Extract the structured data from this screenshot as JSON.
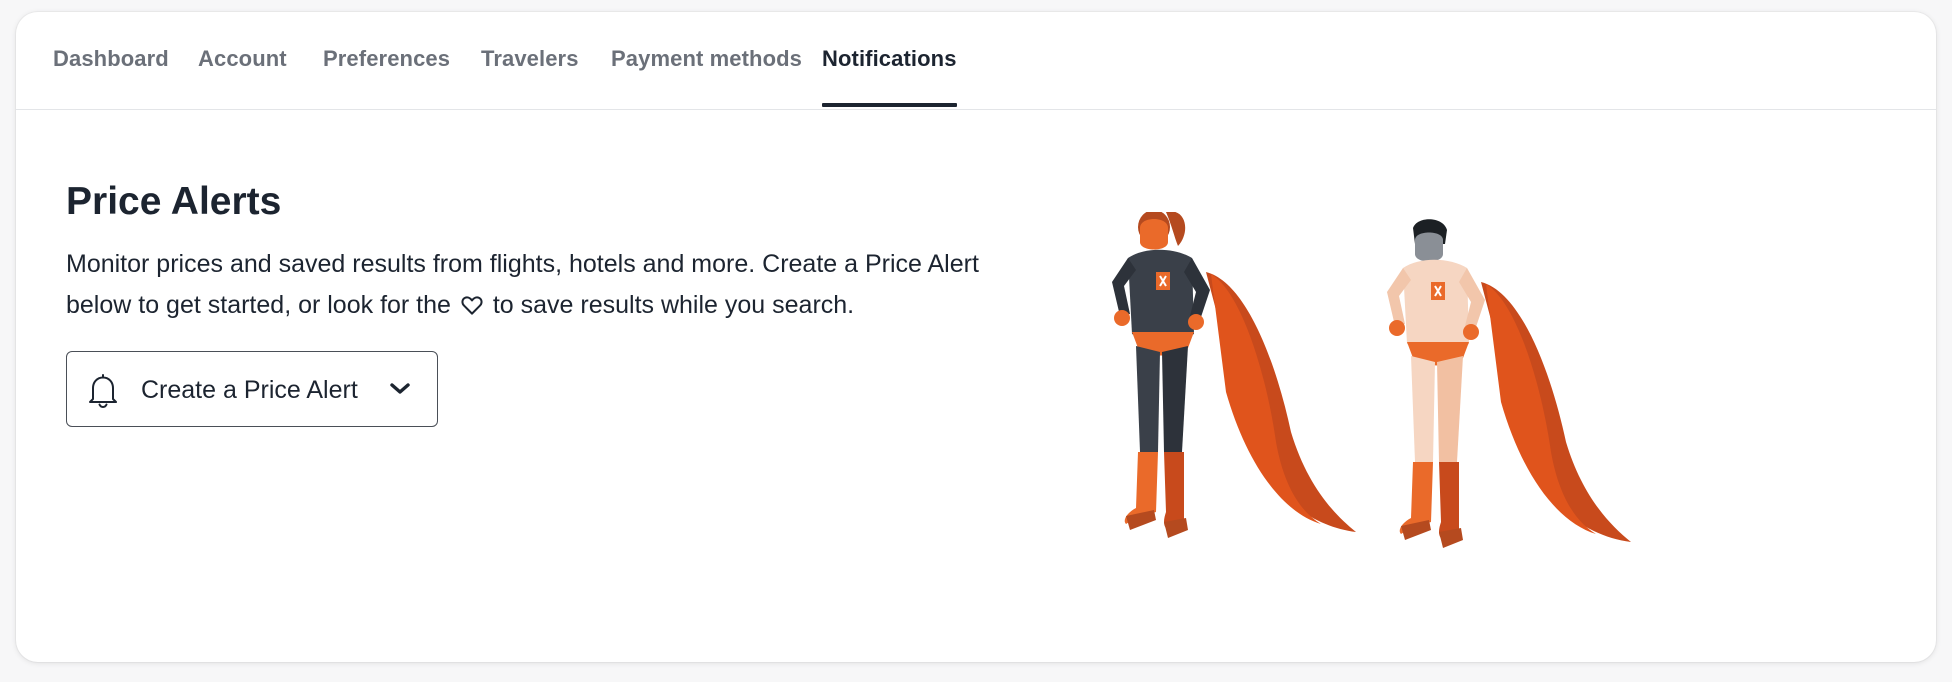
{
  "tabs": [
    {
      "label": "Dashboard",
      "active": false
    },
    {
      "label": "Account",
      "active": false
    },
    {
      "label": "Preferences",
      "active": false
    },
    {
      "label": "Travelers",
      "active": false
    },
    {
      "label": "Payment methods",
      "active": false
    },
    {
      "label": "Notifications",
      "active": true
    }
  ],
  "main": {
    "title": "Price Alerts",
    "description_before_icon": "Monitor prices and saved results from flights, hotels and more. Create a Price Alert below to get started, or look for the",
    "description_icon": "heart-icon",
    "description_after_icon": "to save results while you search.",
    "create_alert": {
      "label": "Create a Price Alert",
      "icon": "bell-icon",
      "dropdown_icon": "chevron-down-icon"
    }
  },
  "illustration": {
    "icon": "superheroes-illustration",
    "colors": {
      "cape": "#e0541c",
      "suit_dark": "#3a4049",
      "suit_light": "#f6d6c2",
      "accent": "#ea6a2a"
    }
  },
  "colors": {
    "text": "#1c2430",
    "muted_tab": "#6b7079",
    "border": "#e3e5e8"
  }
}
